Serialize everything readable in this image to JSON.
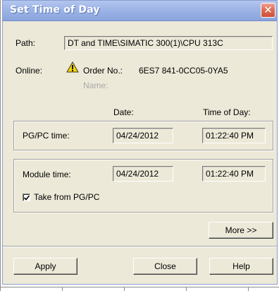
{
  "dialog": {
    "title": "Set Time of Day",
    "close_glyph": "✕"
  },
  "path": {
    "label": "Path:",
    "value": "DT and TIME\\SIMATIC 300(1)\\CPU 313C"
  },
  "online": {
    "label": "Online:",
    "order_label": "Order No.:",
    "order_value": "6ES7 841-0CC05-0YA5",
    "name_label": "Name:",
    "status_icon": "warning-icon"
  },
  "columns": {
    "date_header": "Date:",
    "time_header": "Time of Day:"
  },
  "pgpc": {
    "label": "PG/PC time:",
    "date": "04/24/2012",
    "time": "01:22:40 PM"
  },
  "module": {
    "label": "Module time:",
    "date": "04/24/2012",
    "time": "01:22:40 PM",
    "take_from_label": "Take from PG/PC",
    "take_from_checked": true
  },
  "buttons": {
    "more": "More >>",
    "apply": "Apply",
    "close": "Close",
    "help": "Help"
  },
  "colors": {
    "titlebar": "#9cb4e6",
    "dialog_bg": "#ece9d8",
    "close_button": "#df6a52",
    "warning": "#f5d400"
  }
}
